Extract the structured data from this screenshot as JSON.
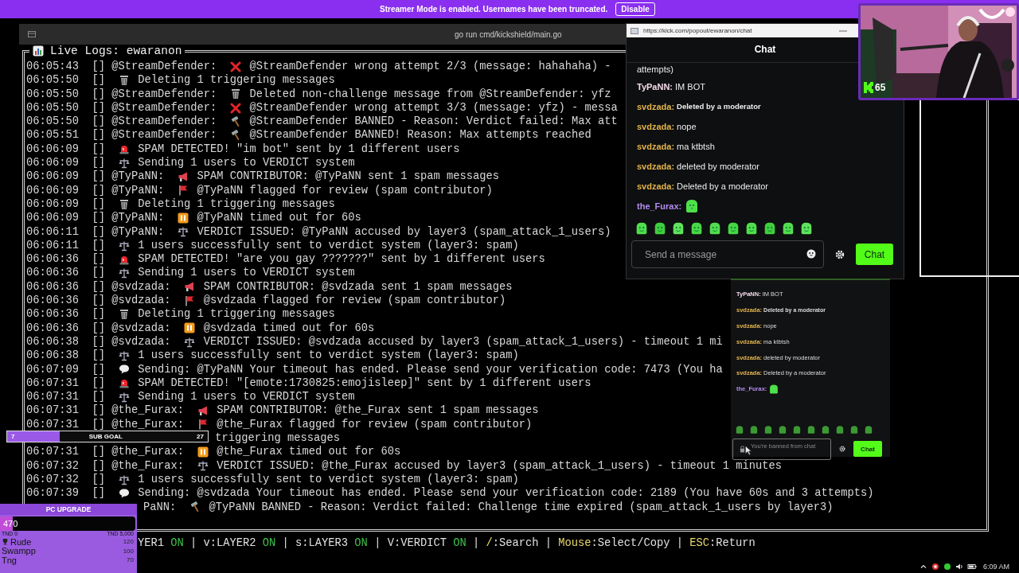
{
  "banner": {
    "text": "Streamer Mode is enabled. Usernames have been truncated.",
    "button": "Disable"
  },
  "terminal": {
    "title": "go run cmd/kickshield/main.go",
    "log_title": "Live Logs: ewaranon",
    "lines": [
      {
        "kind": "cross",
        "time": "06:05:43",
        "tag": "[]",
        "user": "@StreamDefender:",
        "message": "@StreamDefender wrong attempt 2/3 (message: hahahaha) -"
      },
      {
        "kind": "trash",
        "time": "06:05:50",
        "tag": "[]",
        "message": "Deleting 1 triggering messages"
      },
      {
        "kind": "trash",
        "time": "06:05:50",
        "tag": "[]",
        "user": "@StreamDefender:",
        "message": "Deleted non-challenge message from @StreamDefender: yfz"
      },
      {
        "kind": "cross",
        "time": "06:05:50",
        "tag": "[]",
        "user": "@StreamDefender:",
        "message": "@StreamDefender wrong attempt 3/3 (message: yfz) - messa"
      },
      {
        "kind": "hammer",
        "time": "06:05:50",
        "tag": "[]",
        "user": "@StreamDefender:",
        "message": "@StreamDefender BANNED - Reason: Verdict failed: Max att"
      },
      {
        "kind": "hammer",
        "time": "06:05:51",
        "tag": "[]",
        "user": "@StreamDefender:",
        "message": "@StreamDefender BANNED! Reason: Max attempts reached"
      },
      {
        "kind": "siren",
        "time": "06:06:09",
        "tag": "[]",
        "message": "SPAM DETECTED! \"im bot\" sent by 1 different users"
      },
      {
        "kind": "scales",
        "time": "06:06:09",
        "tag": "[]",
        "message": "Sending 1 users to VERDICT system"
      },
      {
        "kind": "megaphone",
        "time": "06:06:09",
        "tag": "[]",
        "user": "@TyPaNN:",
        "message": "SPAM CONTRIBUTOR: @TyPaNN sent 1 spam messages"
      },
      {
        "kind": "flag",
        "time": "06:06:09",
        "tag": "[]",
        "user": "@TyPaNN:",
        "message": "@TyPaNN flagged for review (spam contributor)"
      },
      {
        "kind": "trash",
        "time": "06:06:09",
        "tag": "[]",
        "message": "Deleting 1 triggering messages"
      },
      {
        "kind": "pause",
        "time": "06:06:09",
        "tag": "[]",
        "user": "@TyPaNN:",
        "message": "@TyPaNN timed out for 60s"
      },
      {
        "kind": "scales",
        "time": "06:06:11",
        "tag": "[]",
        "user": "@TyPaNN:",
        "message": "VERDICT ISSUED: @TyPaNN accused by layer3 (spam_attack_1_users)"
      },
      {
        "kind": "scales",
        "time": "06:06:11",
        "tag": "[]",
        "message": "1 users successfully sent to verdict system (layer3: spam)"
      },
      {
        "kind": "siren",
        "time": "06:06:36",
        "tag": "[]",
        "message": "SPAM DETECTED! \"are you gay ???????\" sent by 1 different users"
      },
      {
        "kind": "scales",
        "time": "06:06:36",
        "tag": "[]",
        "message": "Sending 1 users to VERDICT system"
      },
      {
        "kind": "megaphone",
        "time": "06:06:36",
        "tag": "[]",
        "user": "@svdzada:",
        "message": "SPAM CONTRIBUTOR: @svdzada sent 1 spam messages"
      },
      {
        "kind": "flag",
        "time": "06:06:36",
        "tag": "[]",
        "user": "@svdzada:",
        "message": "@svdzada flagged for review (spam contributor)"
      },
      {
        "kind": "trash",
        "time": "06:06:36",
        "tag": "[]",
        "message": "Deleting 1 triggering messages"
      },
      {
        "kind": "pause",
        "time": "06:06:36",
        "tag": "[]",
        "user": "@svdzada:",
        "message": "@svdzada timed out for 60s"
      },
      {
        "kind": "scales",
        "time": "06:06:38",
        "tag": "[]",
        "user": "@svdzada:",
        "message": "VERDICT ISSUED: @svdzada accused by layer3 (spam_attack_1_users) - timeout 1 mi"
      },
      {
        "kind": "scales",
        "time": "06:06:38",
        "tag": "[]",
        "message": "1 users successfully sent to verdict system (layer3: spam)"
      },
      {
        "kind": "speech",
        "time": "06:07:09",
        "tag": "[]",
        "message": "Sending: @TyPaNN Your timeout has ended. Please send your verification code: 7473 (You ha"
      },
      {
        "kind": "siren",
        "time": "06:07:31",
        "tag": "[]",
        "message": "SPAM DETECTED! \"[emote:1730825:emojisleep]\" sent by 1 different users"
      },
      {
        "kind": "scales",
        "time": "06:07:31",
        "tag": "[]",
        "message": "Sending 1 users to VERDICT system"
      },
      {
        "kind": "megaphone",
        "time": "06:07:31",
        "tag": "[]",
        "user": "@the_Furax:",
        "message": "SPAM CONTRIBUTOR: @the_Furax sent 1 spam messages"
      },
      {
        "kind": "flag",
        "time": "06:07:31",
        "tag": "[]",
        "user": "@the_Furax:",
        "message": "@the_Furax flagged for review (spam contributor)"
      },
      {
        "kind": "covered",
        "message": "triggering messages"
      },
      {
        "kind": "pause",
        "time": "06:07:31",
        "tag": "[]",
        "user": "@the_Furax:",
        "message": "@the_Furax timed out for 60s"
      },
      {
        "kind": "scales",
        "time": "06:07:32",
        "tag": "[]",
        "user": "@the_Furax:",
        "message": "VERDICT ISSUED: @the_Furax accused by layer3 (spam_attack_1_users) - timeout 1 minutes"
      },
      {
        "kind": "scales",
        "time": "06:07:32",
        "tag": "[]",
        "message": "1 users successfully sent to verdict system (layer3: spam)"
      },
      {
        "kind": "speech",
        "time": "06:07:39",
        "tag": "[]",
        "message": "Sending: @svdzada Your timeout has ended. Please send your verification code: 2189 (You have 60s and 3 attempts)"
      },
      {
        "kind": "hammer",
        "user": "PaNN:",
        "message": "@TyPaNN BANNED - Reason: Verdict failed: Challenge time expired (spam_attack_1_users by layer3)"
      }
    ],
    "status": [
      {
        "text": "YER1",
        "kind": "label"
      },
      {
        "text": "ON",
        "kind": "on"
      },
      {
        "text": "|",
        "kind": "label"
      },
      {
        "text": "v:LAYER2",
        "kind": "label"
      },
      {
        "text": "ON",
        "kind": "on"
      },
      {
        "text": "|",
        "kind": "label"
      },
      {
        "text": "s:LAYER3",
        "kind": "label"
      },
      {
        "text": "ON",
        "kind": "on"
      },
      {
        "text": "|",
        "kind": "label"
      },
      {
        "text": "V:VERDICT",
        "kind": "label"
      },
      {
        "text": "ON",
        "kind": "on"
      },
      {
        "text": "|",
        "kind": "label"
      },
      {
        "text": "/",
        "kind": "key"
      },
      {
        "text": ":Search",
        "kind": "label"
      },
      {
        "text": "|",
        "kind": "label"
      },
      {
        "text": "Mouse",
        "kind": "key"
      },
      {
        "text": ":Select/Copy",
        "kind": "label"
      },
      {
        "text": "|",
        "kind": "label"
      },
      {
        "text": "ESC",
        "kind": "key"
      },
      {
        "text": ":Return",
        "kind": "label"
      }
    ]
  },
  "chat": {
    "url": "https://kick.com/popout/ewaranon/chat",
    "title": "Chat",
    "messages": [
      {
        "kind": "text",
        "text": "attempts)"
      },
      {
        "kind": "text",
        "user": "TyPaNN:",
        "color": "#f3dbe9",
        "text": "IM BOT"
      },
      {
        "kind": "deleted",
        "user": "svdzada:",
        "color": "#e4b44c",
        "text": "Deleted by a moderator"
      },
      {
        "kind": "text",
        "user": "svdzada:",
        "color": "#e4b44c",
        "text": "nope"
      },
      {
        "kind": "text",
        "user": "svdzada:",
        "color": "#e4b44c",
        "text": "ma ktbtsh"
      },
      {
        "kind": "text",
        "user": "svdzada:",
        "color": "#e4b44c",
        "text": "deleted by moderator"
      },
      {
        "kind": "text",
        "user": "svdzada:",
        "color": "#e4b44c",
        "text": "Deleted by a moderator"
      },
      {
        "kind": "emote",
        "user": "the_Furax:",
        "color": "#b48cf2"
      }
    ],
    "placeholder": "Send a message",
    "send": "Chat"
  },
  "webcam": {
    "count": "65"
  },
  "overlay_chat": {
    "messages": [
      {
        "kind": "text",
        "user": "TyPaNN:",
        "color": "#f3dbe9",
        "text": "IM BOT"
      },
      {
        "kind": "deleted",
        "user": "svdzada:",
        "color": "#e4b44c",
        "text": "Deleted by a moderator"
      },
      {
        "kind": "text",
        "user": "svdzada:",
        "color": "#e4b44c",
        "text": "nope"
      },
      {
        "kind": "text",
        "user": "svdzada:",
        "color": "#e4b44c",
        "text": "ma ktbtsh"
      },
      {
        "kind": "text",
        "user": "svdzada:",
        "color": "#e4b44c",
        "text": "deleted by moderator"
      },
      {
        "kind": "text",
        "user": "svdzada:",
        "color": "#e4b44c",
        "text": "Deleted by a moderator"
      },
      {
        "kind": "emote",
        "user": "the_Furax:",
        "color": "#b48cf2"
      }
    ],
    "placeholder": "You're banned from chat",
    "send": "Chat"
  },
  "sub_goal": {
    "start": "7",
    "title": "SUB GOAL",
    "target": "27",
    "level": 0.26
  },
  "pc_upgrade": {
    "title": "PC UPGRADE",
    "amount": "470",
    "level": 0.094,
    "min": "TND 0",
    "max": "TND 5,000",
    "leaders": [
      {
        "kind": "top",
        "name": "Rude",
        "score": "120"
      },
      {
        "kind": "plain",
        "name": "Swampp",
        "score": "100"
      },
      {
        "kind": "plain",
        "name": "Tng",
        "score": "70"
      }
    ]
  },
  "taskbar": {
    "time": "6:09 AM"
  }
}
